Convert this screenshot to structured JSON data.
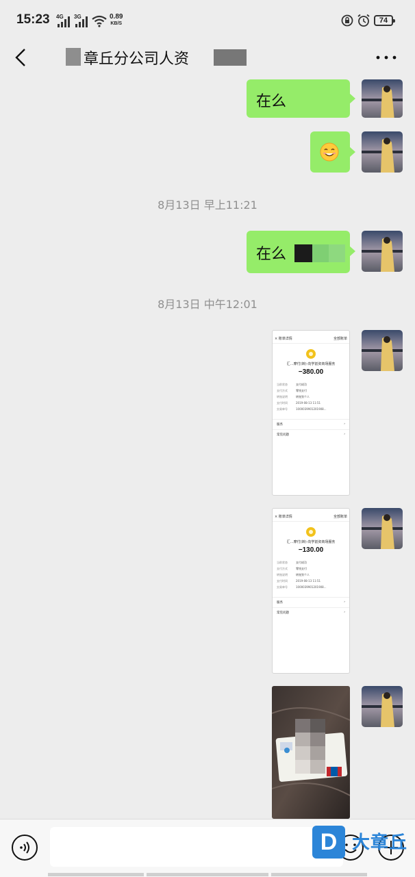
{
  "status_bar": {
    "time": "15:23",
    "net1": "4G",
    "net2": "3G",
    "speed_value": "0.89",
    "speed_unit": "KB/S",
    "battery": "74"
  },
  "header": {
    "title": "章丘分公司人资"
  },
  "messages": {
    "m1_text": "在么",
    "m3_text": "在么",
    "ts1": "8月13日 早上11:21",
    "ts2": "8月13日 中午12:01"
  },
  "screenshots": [
    {
      "header_left": "× 账单详情",
      "header_right": "全部账单",
      "merchant": "汇…摩付(转)-向学前资商场服务",
      "amount": "−380.00",
      "rows": [
        {
          "k": "当前状态",
          "v": "支付成功"
        },
        {
          "k": "支付方式",
          "v": "零钱支付"
        },
        {
          "k": "转账说明",
          "v": "转账到个人"
        },
        {
          "k": "支付时间",
          "v": "2019-08-13 11:51"
        },
        {
          "k": "交易单号",
          "v": "1000039901201908..."
        }
      ],
      "link1": "服务",
      "link2": "常见问题"
    },
    {
      "header_left": "× 账单详情",
      "header_right": "全部账单",
      "merchant": "汇…摩付(转)-向学前资商场服务",
      "amount": "−130.00",
      "rows": [
        {
          "k": "当前状态",
          "v": "支付成功"
        },
        {
          "k": "支付方式",
          "v": "零钱支付"
        },
        {
          "k": "转账说明",
          "v": "转账到个人"
        },
        {
          "k": "支付时间",
          "v": "2019-08-13 11:51"
        },
        {
          "k": "交易单号",
          "v": "1000039901201908..."
        }
      ],
      "link1": "服务",
      "link2": "常见问题"
    }
  ],
  "input_bar": {
    "placeholder": ""
  },
  "watermark": {
    "logo_letter": "D",
    "text": "大章丘"
  },
  "colors": {
    "bubble": "#95ec69",
    "background": "#ededed",
    "watermark": "#2c85d8"
  }
}
